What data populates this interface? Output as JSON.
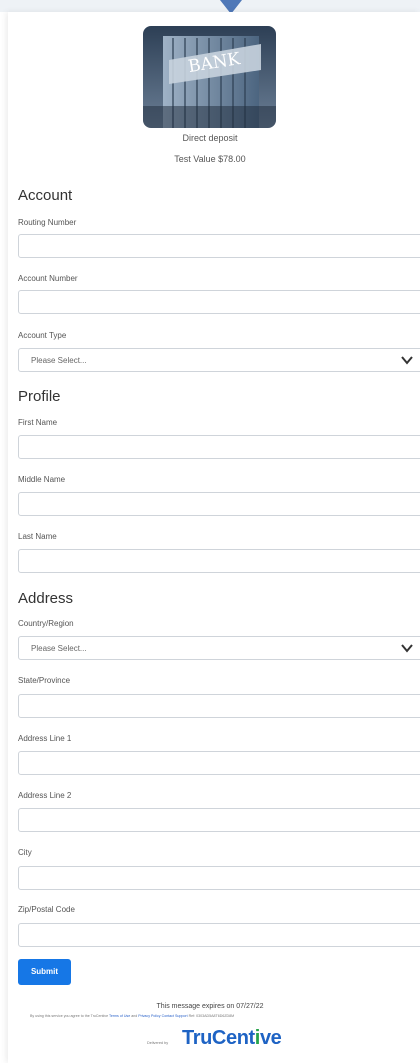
{
  "reward": {
    "image_alt": "BANK",
    "title": "Direct deposit",
    "value": "Test Value $78.00"
  },
  "account": {
    "section_title": "Account",
    "routing_label": "Routing Number",
    "account_number_label": "Account Number",
    "account_type_label": "Account Type",
    "account_type_value": "Please Select..."
  },
  "profile": {
    "section_title": "Profile",
    "first_name_label": "First Name",
    "middle_name_label": "Middle Name",
    "last_name_label": "Last Name"
  },
  "address": {
    "section_title": "Address",
    "country_label": "Country/Region",
    "country_value": "Please Select...",
    "state_label": "State/Province",
    "line1_label": "Address Line 1",
    "line2_label": "Address Line 2",
    "city_label": "City",
    "zip_label": "Zip/Postal Code"
  },
  "submit_label": "Submit",
  "footer": {
    "expires": "This message expires on 07/27/22",
    "consent_prefix": "By using this service you agree to the TruCentive",
    "terms_link": "Terms of Use",
    "and_text": "and",
    "privacy_link": "Privacy Policy",
    "support_link": "Contact Support",
    "ref_text": "Ref: 0303AD5A8T6D6ZD8M",
    "powered_by": "Delivered by",
    "logo_tru": "Tru",
    "logo_cent": "Cent",
    "logo_i": "i",
    "logo_ve": "ve"
  },
  "colors": {
    "accent": "#1677e6",
    "brand_blue": "#1e63c4",
    "brand_green": "#27a34a"
  }
}
